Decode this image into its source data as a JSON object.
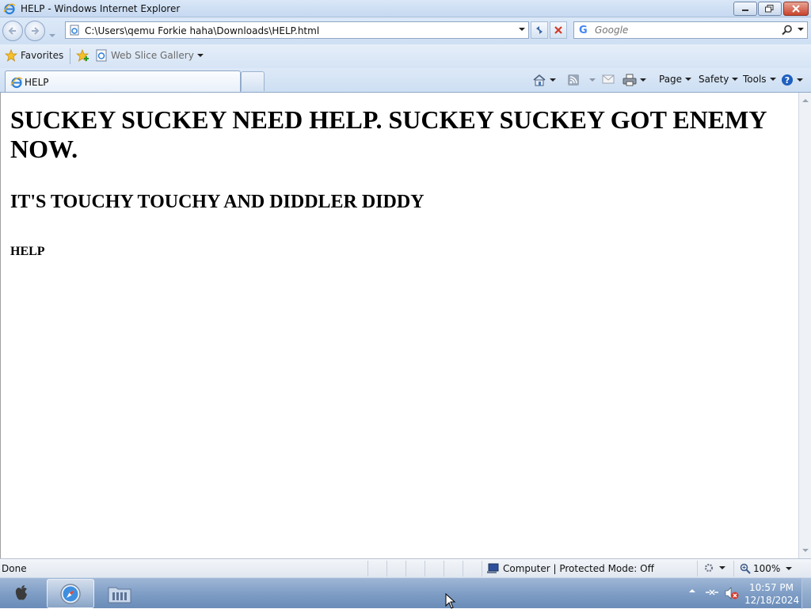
{
  "window": {
    "title": "HELP - Windows Internet Explorer"
  },
  "address_bar": {
    "url": "C:\\Users\\qemu Forkie haha\\Downloads\\HELP.html",
    "search_placeholder": "Google"
  },
  "favorites_bar": {
    "favorites_label": "Favorites",
    "web_slice_label": "Web Slice Gallery"
  },
  "tabs": [
    {
      "label": "HELP"
    }
  ],
  "command_bar": {
    "page_label": "Page",
    "safety_label": "Safety",
    "tools_label": "Tools"
  },
  "content": {
    "h1": "SUCKEY SUCKEY NEED HELP. SUCKEY SUCKEY GOT ENEMY NOW.",
    "h2": "IT'S TOUCHY TOUCHY AND DIDDLER DIDDY",
    "h4": "HELP"
  },
  "status_bar": {
    "status": "Done",
    "zone": "Computer | Protected Mode: Off",
    "zoom": "100%"
  },
  "taskbar": {
    "time": "10:57 PM",
    "date": "12/18/2024"
  },
  "icons": {
    "ie": "ie-logo-icon",
    "back": "back-arrow-icon",
    "forward": "forward-arrow-icon",
    "refresh": "refresh-icon",
    "stop": "stop-icon",
    "search": "magnifier-icon",
    "favorites": "star-icon",
    "home": "home-icon",
    "feeds": "rss-icon",
    "mail": "mail-icon",
    "print": "printer-icon",
    "help": "help-icon"
  },
  "colors": {
    "chrome": "#cfdff3",
    "taskbar": "#7d9cc4",
    "close_button": "#c8442d",
    "help_blue": "#1f5fbf"
  }
}
